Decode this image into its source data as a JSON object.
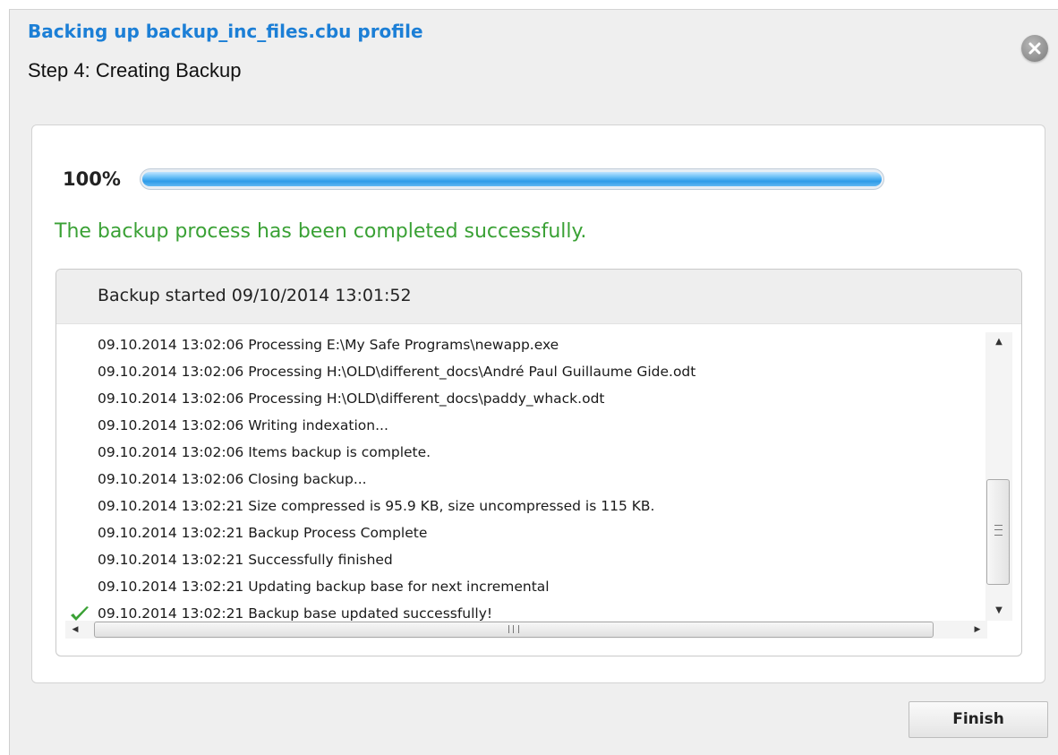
{
  "window": {
    "title": "Backing up backup_inc_files.cbu profile",
    "step": "Step 4: Creating Backup",
    "close_icon": "close-icon"
  },
  "progress": {
    "percent_label": "100%",
    "value_percent": 100,
    "status_message": "The backup process has been completed successfully.",
    "status_color": "#3aa135"
  },
  "log": {
    "header": "Backup started 09/10/2014 13:01:52",
    "lines": [
      {
        "text": "09.10.2014 13:02:06 Processing E:\\My Safe Programs\\newapp.exe",
        "icon": ""
      },
      {
        "text": "09.10.2014 13:02:06 Processing H:\\OLD\\different_docs\\André Paul Guillaume Gide.odt",
        "icon": ""
      },
      {
        "text": "09.10.2014 13:02:06 Processing H:\\OLD\\different_docs\\paddy_whack.odt",
        "icon": ""
      },
      {
        "text": "09.10.2014 13:02:06 Writing indexation...",
        "icon": ""
      },
      {
        "text": "09.10.2014 13:02:06 Items backup is complete.",
        "icon": ""
      },
      {
        "text": "09.10.2014 13:02:06 Closing backup...",
        "icon": ""
      },
      {
        "text": "09.10.2014 13:02:21 Size compressed is 95.9 KB, size uncompressed is 115 KB.",
        "icon": ""
      },
      {
        "text": "09.10.2014 13:02:21 Backup Process Complete",
        "icon": ""
      },
      {
        "text": "09.10.2014 13:02:21 Successfully finished",
        "icon": ""
      },
      {
        "text": "09.10.2014 13:02:21 Updating backup base for next incremental",
        "icon": ""
      },
      {
        "text": "09.10.2014 13:02:21 Backup base updated successfully!",
        "icon": "green-checkmark-icon"
      }
    ]
  },
  "buttons": {
    "finish_label": "Finish"
  },
  "colors": {
    "title": "#1c7fd6",
    "progress_fill": "#2e9be8"
  }
}
